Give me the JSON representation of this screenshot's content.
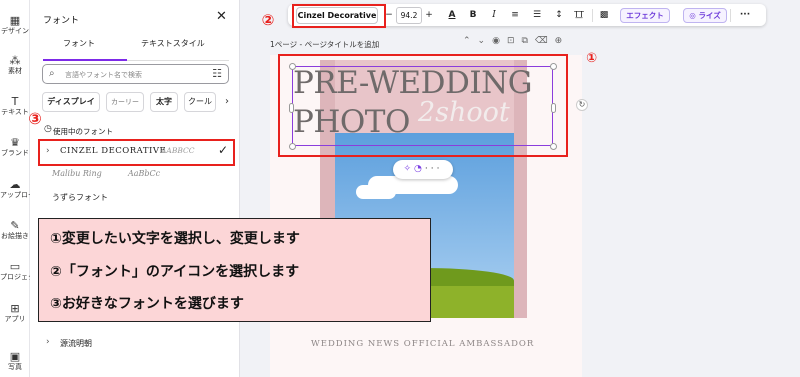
{
  "rail": [
    {
      "label": "デザイン",
      "icon": "design-icon"
    },
    {
      "label": "素材",
      "icon": "elements-icon"
    },
    {
      "label": "テキスト",
      "icon": "text-icon"
    },
    {
      "label": "ブランド",
      "icon": "brand-icon"
    },
    {
      "label": "アップロード",
      "icon": "upload-icon"
    },
    {
      "label": "お絵描き",
      "icon": "draw-icon"
    },
    {
      "label": "プロジェクト",
      "icon": "projects-icon"
    },
    {
      "label": "アプリ",
      "icon": "apps-icon"
    },
    {
      "label": "写真",
      "icon": "photos-icon"
    }
  ],
  "panel": {
    "title": "フォント",
    "close": "✕",
    "tabs": [
      "フォント",
      "テキストスタイル"
    ],
    "search_placeholder": "言語やフォント名で検索",
    "chips": [
      "ディスプレイ",
      "カーリー",
      "太字",
      "クール"
    ],
    "section": "使用中のフォント",
    "fonts": [
      {
        "name": "CINZEL DECORATIVE",
        "sample": "AABBCC"
      },
      {
        "name": "Malibu Ring",
        "sample": "AaBbCc"
      },
      {
        "name": "うずらフォント"
      },
      {
        "name": "源流明朝"
      }
    ]
  },
  "toolbar": {
    "font": "Cinzel Decorative",
    "minus": "−",
    "size": "94.2",
    "plus": "+",
    "text_color": "A",
    "bold": "B",
    "italic": "I",
    "align": "≡",
    "list": "☰",
    "spacing": "↕",
    "transform": "T͟T",
    "transparency": "▩",
    "effect": "エフェクト",
    "rise": "ライズ",
    "more": "···"
  },
  "page": {
    "title": "1ページ - ページタイトルを追加"
  },
  "canvas": {
    "line1": "PRE-WEDDING",
    "line2": "PHOTO",
    "script": "2shoot",
    "footer": "WEDDING NEWS OFFICIAL AMBASSADOR"
  },
  "annotations": {
    "num1": "①",
    "num2": "②",
    "num3": "③",
    "instructions": [
      "①変更したい文字を選択し、変更します",
      "②「フォント」のアイコンを選択します",
      "③お好きなフォントを選びます"
    ]
  },
  "colors": {
    "accent": "#7d2ae8",
    "highlight": "#e8211d",
    "instruction_bg": "#fcd6d7"
  }
}
